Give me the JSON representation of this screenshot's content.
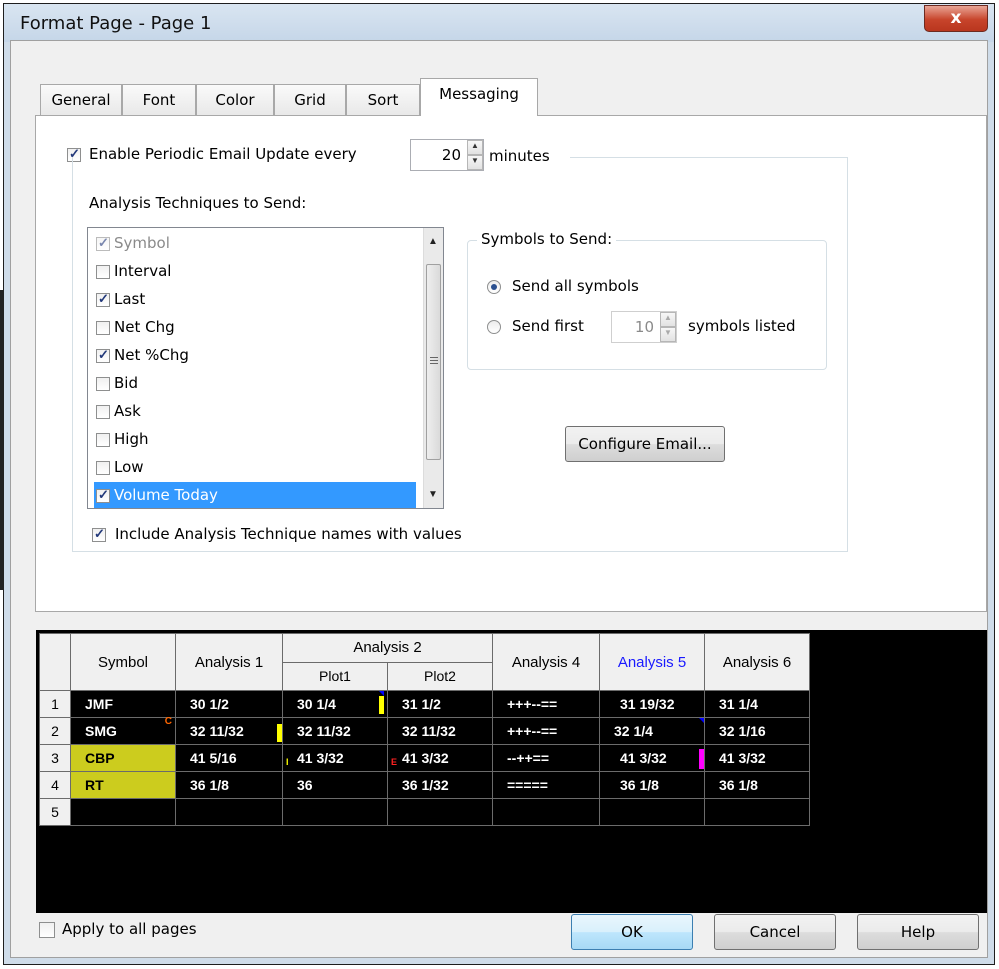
{
  "window": {
    "title": "Format Page - Page 1",
    "close_label": "x"
  },
  "tabs": [
    "General",
    "Font",
    "Color",
    "Grid",
    "Sort",
    "Messaging"
  ],
  "messaging": {
    "enable_label": "Enable Periodic Email Update every",
    "enable_checked": true,
    "interval_value": "20",
    "interval_unit": "minutes",
    "techniques_label": "Analysis Techniques to Send:",
    "techniques": [
      {
        "label": "Symbol",
        "checked": true,
        "disabled": true
      },
      {
        "label": "Interval",
        "checked": false
      },
      {
        "label": "Last",
        "checked": true
      },
      {
        "label": "Net Chg",
        "checked": false
      },
      {
        "label": "Net %Chg",
        "checked": true
      },
      {
        "label": "Bid",
        "checked": false
      },
      {
        "label": "Ask",
        "checked": false
      },
      {
        "label": "High",
        "checked": false
      },
      {
        "label": "Low",
        "checked": false
      },
      {
        "label": "Volume Today",
        "checked": true,
        "selected": true
      }
    ],
    "include_names_label": "Include Analysis Technique names with values",
    "include_names_checked": true,
    "symbols_group_label": "Symbols to Send:",
    "send_all_label": "Send all symbols",
    "send_first_label": "Send first",
    "send_first_value": "10",
    "symbols_listed_label": "symbols listed",
    "configure_email_label": "Configure Email..."
  },
  "grid": {
    "headers": {
      "symbol": "Symbol",
      "analysis1": "Analysis 1",
      "analysis2": "Analysis 2",
      "plot1": "Plot1",
      "plot2": "Plot2",
      "analysis4": "Analysis 4",
      "analysis5": "Analysis 5",
      "analysis6": "Analysis 6"
    },
    "rows": [
      {
        "n": "1",
        "symbol": "JMF",
        "a1": "30  1/2",
        "p1": "30  1/4",
        "p2": "31  1/2",
        "a4": "+++--==",
        "a5": "31  19/32",
        "a6": "31  1/4"
      },
      {
        "n": "2",
        "symbol": "SMG",
        "a1": "32  11/32",
        "p1": "32  11/32",
        "p2": "32  11/32",
        "a4": "+++--==",
        "a5": "32  1/4",
        "a6": "32  1/16"
      },
      {
        "n": "3",
        "symbol": "CBP",
        "a1": "41  5/16",
        "p1": "41  3/32",
        "p2": "41  3/32",
        "a4": "--++==",
        "a5": "41  3/32",
        "a6": "41  3/32"
      },
      {
        "n": "4",
        "symbol": "RT",
        "a1": "36  1/8",
        "p1": "36",
        "p2": "36  1/32",
        "a4": "=====",
        "a5": "36  1/8",
        "a6": "36  1/8"
      },
      {
        "n": "5",
        "symbol": "",
        "a1": "",
        "p1": "",
        "p2": "",
        "a4": "",
        "a5": "",
        "a6": ""
      }
    ],
    "markers": {
      "smg_symbol": "C",
      "cbp_plot1": "I",
      "cbp_plot2": "E"
    },
    "colors": {
      "analysis5_header": "#1a1aff",
      "symbol_highlight": "#cccc1e",
      "marker_yellow": "#ffff00",
      "marker_magenta": "#ff00ff",
      "marker_blue": "#0000ff"
    }
  },
  "footer": {
    "apply_all_label": "Apply to all pages",
    "apply_all_checked": false,
    "ok_label": "OK",
    "cancel_label": "Cancel",
    "help_label": "Help"
  }
}
